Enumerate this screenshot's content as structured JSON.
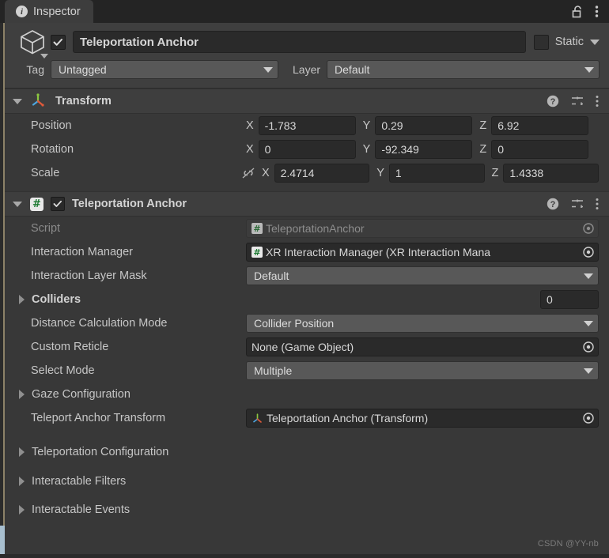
{
  "window": {
    "tab_label": "Inspector",
    "tab_icon": "info-icon",
    "lock_icon": "unlocked-padlock-icon",
    "menu_icon": "kebab-menu-icon"
  },
  "game_object": {
    "icon": "cube-icon",
    "enabled_checkbox": true,
    "name": "Teleportation Anchor",
    "static_label": "Static",
    "static_checked": false,
    "tag_label": "Tag",
    "tag_value": "Untagged",
    "layer_label": "Layer",
    "layer_value": "Default"
  },
  "transform": {
    "title": "Transform",
    "icon": "transform-axis-gizmo-icon",
    "expanded": true,
    "help_icon": "help-circle-icon",
    "preset_icon": "preset-sliders-icon",
    "menu_icon": "kebab-menu-icon",
    "rows": [
      {
        "label": "Position",
        "link_icon": null,
        "x": "-1.783",
        "y": "0.29",
        "z": "6.92"
      },
      {
        "label": "Rotation",
        "link_icon": null,
        "x": "0",
        "y": "-92.349",
        "z": "0"
      },
      {
        "label": "Scale",
        "link_icon": "constrained-proportions-off-icon",
        "x": "2.4714",
        "y": "1",
        "z": "1.4338"
      }
    ],
    "axis_x": "X",
    "axis_y": "Y",
    "axis_z": "Z"
  },
  "teleportation_anchor": {
    "title": "Teleportation Anchor",
    "icon": "csharp-script-icon",
    "expanded": true,
    "enabled_checkbox": true,
    "help_icon": "help-circle-icon",
    "preset_icon": "preset-sliders-icon",
    "menu_icon": "kebab-menu-icon",
    "script": {
      "label": "Script",
      "value": "TeleportationAnchor",
      "icon": "csharp-script-icon",
      "picker_icon": "object-picker-icon",
      "disabled": true
    },
    "interaction_manager": {
      "label": "Interaction Manager",
      "value": "XR Interaction Manager (XR Interaction Mana",
      "icon": "csharp-script-icon",
      "picker_icon": "object-picker-icon"
    },
    "interaction_layer_mask": {
      "label": "Interaction Layer Mask",
      "value": "Default"
    },
    "colliders": {
      "label": "Colliders",
      "count": "0",
      "expanded": false
    },
    "distance_calculation_mode": {
      "label": "Distance Calculation Mode",
      "value": "Collider Position"
    },
    "custom_reticle": {
      "label": "Custom Reticle",
      "value": "None (Game Object)",
      "picker_icon": "object-picker-icon"
    },
    "select_mode": {
      "label": "Select Mode",
      "value": "Multiple"
    },
    "gaze_configuration": {
      "label": "Gaze Configuration",
      "expanded": false
    },
    "teleport_anchor_transform": {
      "label": "Teleport Anchor Transform",
      "value": "Teleportation Anchor (Transform)",
      "icon": "transform-axis-gizmo-icon",
      "picker_icon": "object-picker-icon"
    },
    "foldouts": [
      {
        "label": "Teleportation Configuration",
        "expanded": false
      },
      {
        "label": "Interactable Filters",
        "expanded": false
      },
      {
        "label": "Interactable Events",
        "expanded": false
      }
    ]
  },
  "watermark": "CSDN @YY-nb",
  "colors": {
    "panel_bg": "#383838",
    "header_bg": "#3e3e3e",
    "tabbar_bg": "#242424",
    "field_bg": "#2a2a2a",
    "dropdown_bg": "#585858",
    "text": "#c6c6c6",
    "accent_strip": "#8c8268"
  }
}
